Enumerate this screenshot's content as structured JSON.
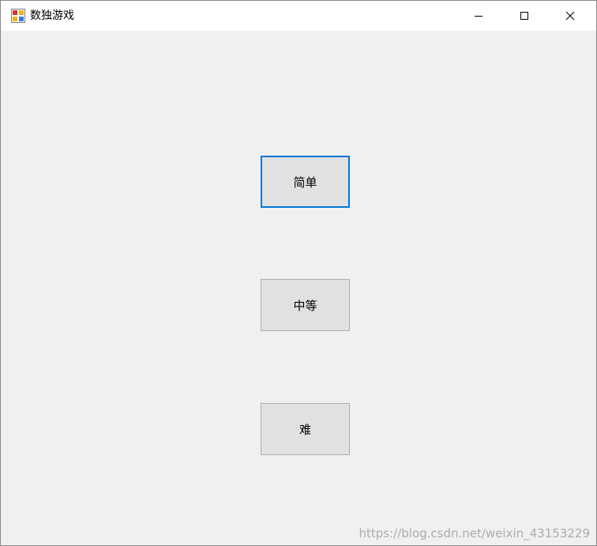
{
  "window": {
    "title": "数独游戏",
    "app_icon": "winforms-app-icon",
    "controls": {
      "minimize_icon": "minimize-icon",
      "maximize_icon": "maximize-icon",
      "close_icon": "close-icon"
    }
  },
  "difficulty_buttons": [
    {
      "label": "简单",
      "focused": true
    },
    {
      "label": "中等",
      "focused": false
    },
    {
      "label": "难",
      "focused": false
    }
  ],
  "watermark": "https://blog.csdn.net/weixin_43153229",
  "colors": {
    "focus_border": "#0078d7",
    "button_face": "#e1e1e1",
    "button_border": "#adadad",
    "client_background": "#f0f0f0",
    "titlebar_background": "#ffffff"
  }
}
